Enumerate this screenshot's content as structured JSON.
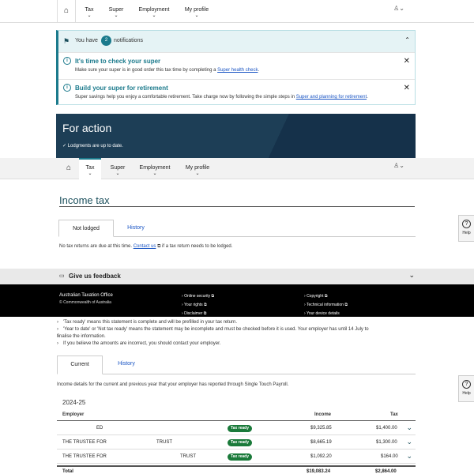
{
  "nav1": {
    "items": [
      {
        "label": "Tax"
      },
      {
        "label": "Super"
      },
      {
        "label": "Employment"
      },
      {
        "label": "My profile"
      }
    ]
  },
  "notifications": {
    "prefix": "You have",
    "count": "2",
    "suffix": "notifications",
    "items": [
      {
        "title": "It's time to check your super",
        "body_pre": "Make sure your super is in good order this tax time by completing a ",
        "link": "Super health check",
        "body_post": "."
      },
      {
        "title": "Build your super for retirement",
        "body_pre": "Super savings help you enjoy a comfortable retirement. Take charge now by following the simple steps in ",
        "link": "Super and planning for retirement",
        "body_post": "."
      }
    ]
  },
  "for_action": {
    "heading": "For action",
    "status": "✓ Lodgments are up to date."
  },
  "nav2": {
    "items": [
      {
        "label": "Tax"
      },
      {
        "label": "Super"
      },
      {
        "label": "Employment"
      },
      {
        "label": "My profile"
      }
    ]
  },
  "income_tax": {
    "title": "Income tax",
    "tabs": [
      {
        "label": "Not lodged"
      },
      {
        "label": "History"
      }
    ],
    "note_pre": "No tax returns are due at this time. ",
    "note_link": "Contact us",
    "note_post": " if a tax return needs to be lodged."
  },
  "help": {
    "label": "Help"
  },
  "feedback": {
    "label": "Give us feedback"
  },
  "footer": {
    "org": "Australian Taxation Office",
    "copyright_line": "© Commonwealth of Australia",
    "links": [
      {
        "label": "Online security"
      },
      {
        "label": "Your rights"
      },
      {
        "label": "Disclaimer"
      },
      {
        "label": "Copyright"
      },
      {
        "label": "Technical information"
      },
      {
        "label": "Your device details"
      }
    ]
  },
  "bullets": [
    "'Tax ready' means this statement is complete and will be prefilled in your tax return.",
    "'Year to date' or 'Not tax ready' means the statement may be incomplete and must be checked before it is used. Your employer has until 14 July to",
    "finalise the information.",
    "If you believe the amounts are incorrect, you should contact your employer."
  ],
  "income": {
    "tabs": [
      {
        "label": "Current"
      },
      {
        "label": "History"
      }
    ],
    "intro": "Income details for the current and previous year that your employer has reported through Single Touch Payroll.",
    "year": "2024-25",
    "headers": {
      "employer": "Employer",
      "income": "Income",
      "tax": "Tax"
    },
    "rows": [
      {
        "employer_a": "ED",
        "employer_b": "",
        "status": "Tax ready",
        "income": "$9,325.85",
        "tax": "$1,400.00"
      },
      {
        "employer_a": "THE TRUSTEE FOR",
        "employer_b": "TRUST",
        "status": "Tax ready",
        "income": "$8,665.19",
        "tax": "$1,300.00"
      },
      {
        "employer_a": "THE TRUSTEE FOR",
        "employer_b": "TRUST",
        "status": "Tax ready",
        "income": "$1,092.20",
        "tax": "$164.00"
      }
    ],
    "total": {
      "label": "Total",
      "income": "$19,083.24",
      "tax": "$2,864.00"
    }
  }
}
